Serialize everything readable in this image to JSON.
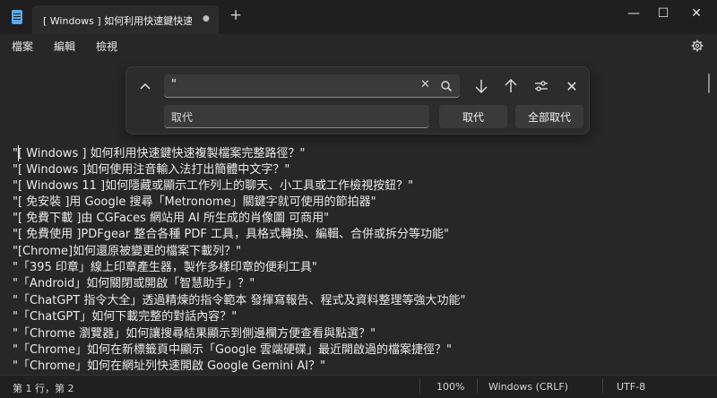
{
  "tab": {
    "title": "[ Windows ] 如何利用快速鍵快速複",
    "dot": "●",
    "new_tab": "+"
  },
  "window_controls": {
    "minimize": "—",
    "maximize": "☐",
    "close": "✕"
  },
  "menu": {
    "file": "檔案",
    "edit": "編輯",
    "view": "檢視"
  },
  "find": {
    "expand_glyph": "⌃",
    "search_value": "\"",
    "clear_glyph": "✕",
    "next_glyph": "↓",
    "prev_glyph": "↑",
    "options_glyph": "⚙",
    "close_glyph": "✕",
    "replace_placeholder": "取代",
    "replace_label": "取代",
    "replace_all_label": "全部取代"
  },
  "editor": {
    "lines": [
      "\"[ Windows ] 如何利用快速鍵快速複製檔案完整路徑？\"",
      "\"[ Windows ]如何使用注音輸入法打出簡體中文字？\"",
      "\"[ Windows 11 ]如何隱藏或顯示工作列上的聊天、小工具或工作檢視按鈕？\"",
      "\"[ 免安裝 ]用 Google 搜尋「Metronome」關鍵字就可使用的節拍器\"",
      "\"[ 免費下載 ]由 CGFaces 網站用 AI 所生成的肖像圖 可商用\"",
      "\"[ 免費使用 ]PDFgear 整合各種 PDF 工具，具格式轉換、編輯、合併或拆分等功能\"",
      "\"[Chrome]如何還原被變更的檔案下載列？\"",
      "\"「395 印章」線上印章產生器，製作多樣印章的便利工具\"",
      "\"「Android」如何關閉或開啟「智慧助手」？\"",
      "\"「ChatGPT 指令大全」透過精煉的指令範本 發揮寫報告、程式及資料整理等強大功能\"",
      "\"「ChatGPT」如何下載完整的對話內容？\"",
      "\"「Chrome 瀏覽器」如何讓搜尋結果顯示到側邊欄方便查看與點選？\"",
      "\"「Chrome」如何在新標籤頁中顯示「Google 雲端硬碟」最近開啟過的檔案捷徑？\"",
      "\"「Chrome」如何在網址列快速開啟 Google Gemini AI？\""
    ]
  },
  "status": {
    "position": "第 1 行，第 2",
    "zoom": "100%",
    "line_ending": "Windows (CRLF)",
    "encoding": "UTF-8"
  }
}
